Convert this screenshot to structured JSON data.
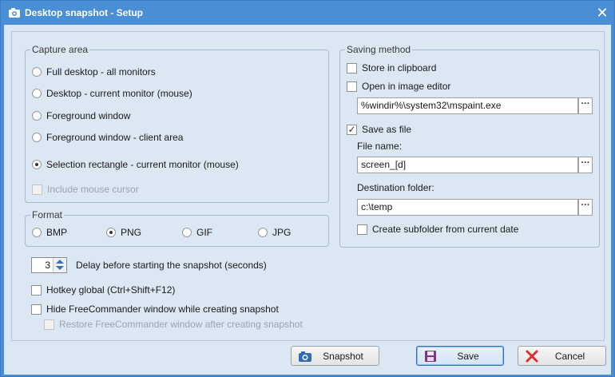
{
  "window": {
    "title": "Desktop snapshot - Setup",
    "title_icon": "camera-icon",
    "close_icon": "close-icon",
    "close_glyph": "✕"
  },
  "capture_area": {
    "legend": "Capture area",
    "options": [
      {
        "label": "Full desktop - all monitors",
        "checked": false
      },
      {
        "label": "Desktop - current monitor (mouse)",
        "checked": false
      },
      {
        "label": "Foreground window",
        "checked": false
      },
      {
        "label": "Foreground window - client area",
        "checked": false
      },
      {
        "label": "Selection rectangle - current monitor (mouse)",
        "checked": true
      }
    ],
    "include_mouse_cursor": {
      "label": "Include mouse cursor",
      "checked": false,
      "disabled": true
    }
  },
  "format": {
    "legend": "Format",
    "options": [
      {
        "label": "BMP",
        "checked": false
      },
      {
        "label": "PNG",
        "checked": true
      },
      {
        "label": "GIF",
        "checked": false
      },
      {
        "label": "JPG",
        "checked": false
      }
    ]
  },
  "saving_method": {
    "legend": "Saving method",
    "store_in_clipboard": {
      "label": "Store in clipboard",
      "checked": false
    },
    "open_in_image_editor": {
      "label": "Open in image editor",
      "checked": false
    },
    "image_editor_path": "%windir%\\system32\\mspaint.exe",
    "save_as_file": {
      "label": "Save as file",
      "checked": true
    },
    "file_name_label": "File name:",
    "file_name_value": "screen_[d]",
    "destination_folder_label": "Destination folder:",
    "destination_folder_value": "c:\\temp",
    "create_subfolder": {
      "label": "Create subfolder from current date",
      "checked": false
    },
    "browse_glyph": "···"
  },
  "delay": {
    "value": "3",
    "label": "Delay before starting the snapshot (seconds)"
  },
  "hotkey_global": {
    "label": "Hotkey global (Ctrl+Shift+F12)",
    "checked": false
  },
  "hide_window": {
    "label": "Hide FreeCommander window while creating snapshot",
    "checked": false
  },
  "restore_window": {
    "label": "Restore FreeCommander window after creating snapshot",
    "checked": false,
    "disabled": true
  },
  "buttons": {
    "snapshot": {
      "label": "Snapshot",
      "icon": "camera-icon"
    },
    "save": {
      "label": "Save",
      "icon": "floppy-disk-icon"
    },
    "cancel": {
      "label": "Cancel",
      "icon": "red-x-icon"
    }
  },
  "colors": {
    "titlebar": "#4a8fd6",
    "client_bg": "#dce7f4",
    "cancel_icon": "#d9302a",
    "save_icon": "#7a3b7a"
  }
}
